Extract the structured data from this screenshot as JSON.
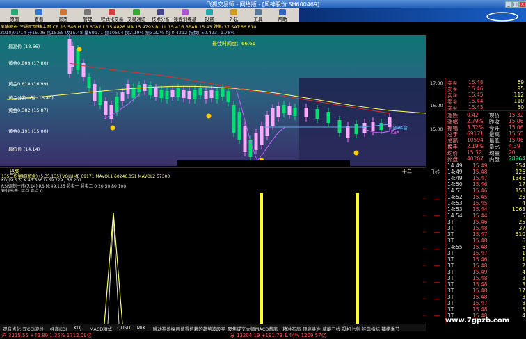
{
  "window": {
    "title": "飞狐交易师 - 网络版 - [风神股份 SH600469]"
  },
  "toolbar": {
    "buttons": [
      "页面",
      "查看",
      "画面",
      "管理",
      "程式化交易",
      "交易通证",
      "技术分析",
      "操盘训练基地",
      "投资",
      "外延",
      "工具",
      "帮助"
    ]
  },
  "info_row1": "风神股份  三线汇聚神主图  CB 15.546  H 15.6087  L 15.4826  MA 15.4793  BULL 15.416  BEAR 15.43  跌勤 37  SAT:66.810",
  "info_row2": "2010/01/14  开15.06 高15.55 收15.48 量69171 额10594  换2.19% 振3.32% 均 0.4212 指数(-50.423)-1.78%",
  "chart": {
    "levels": [
      {
        "label": "最高价 (18.66)"
      },
      {
        "label": "黄金0.809 (17.80)"
      },
      {
        "label": "黄金0.618 (16.99)"
      },
      {
        "label": "黄金分割中轴 (16.40)"
      },
      {
        "label": "黄金0.382 (15.87)"
      },
      {
        "label": "黄金0.191 (15.00)"
      },
      {
        "label": "最低价 (14.14)"
      }
    ],
    "sentiment": "最佳时间度：66.61",
    "right_ticks": [
      "17.00",
      "16.00",
      "15.00"
    ],
    "annotation": "风神平台",
    "annotation2": "KBA"
  },
  "subchart": {
    "row1": "135日均量线(解盘) (5,35,135)  VOLUME 69171  MAVOL1 60246.051  MAVOL2 57300",
    "row2": "KDJ(9,3,3) K 45.886  D 39.729  J 58.201",
    "row3": "RSI调制一纬(7,14)  RSIM:49.136  超卖一  超卖二 0 20 50 80 100",
    "row4": "短线出击: 买点 卖点 0",
    "label_left": "巴黎",
    "label_mid": "十二"
  },
  "lower_ticks": [
    "",
    "",
    "",
    "",
    "",
    "",
    "",
    ""
  ],
  "side": {
    "asks": [
      {
        "label": "卖⑤",
        "price": "15.48",
        "vol": "69"
      },
      {
        "label": "卖④",
        "price": "15.46",
        "vol": "95"
      },
      {
        "label": "卖③",
        "price": "15.45",
        "vol": "112"
      },
      {
        "label": "卖②",
        "price": "15.44",
        "vol": "110"
      },
      {
        "label": "卖①",
        "price": "15.43",
        "vol": "50"
      }
    ],
    "stats": [
      {
        "l": "涨跌",
        "v": "0.42",
        "l2": "现价",
        "v2": "15.32"
      },
      {
        "l": "涨幅",
        "v": "2.79%",
        "l2": "昨收",
        "v2": "15.06"
      },
      {
        "l": "振幅",
        "v": "3.32%",
        "l2": "今开",
        "v2": "15.06"
      },
      {
        "l": "总手",
        "v": "69171",
        "l2": "最高",
        "v2": "15.55"
      },
      {
        "l": "总额",
        "v": "10594",
        "l2": "最低",
        "v2": "15.06"
      },
      {
        "l": "换手",
        "v": "2.19%",
        "l2": "量比",
        "v2": "4.39"
      },
      {
        "l": "均价",
        "v": "15.32",
        "l2": "均量",
        "v2": "20"
      }
    ],
    "waipan": {
      "l": "外盘",
      "v": "40207",
      "l2": "内盘",
      "v2": "28964"
    },
    "ticks": [
      {
        "t": "14:49",
        "p": "15.49",
        "v": "354"
      },
      {
        "t": "14:49",
        "p": "15.48",
        "v": "126"
      },
      {
        "t": "14:49",
        "p": "15.47",
        "v": "1346"
      },
      {
        "t": "14:50",
        "p": "15.46",
        "v": "17"
      },
      {
        "t": "14:51",
        "p": "15.46",
        "v": "153"
      },
      {
        "t": "14:52",
        "p": "15.45",
        "v": "25"
      },
      {
        "t": "14:53",
        "p": "15.45",
        "v": "4"
      },
      {
        "t": "14:53",
        "p": "15.44",
        "v": "1063"
      },
      {
        "t": "14:54",
        "p": "15.44",
        "v": "5"
      },
      {
        "t": "3T",
        "p": "15.46",
        "v": "25"
      },
      {
        "t": "3T",
        "p": "15.48",
        "v": "37"
      },
      {
        "t": "3T",
        "p": "15.47",
        "v": "510"
      },
      {
        "t": "3T",
        "p": "15.48",
        "v": "6"
      },
      {
        "t": "14:55",
        "p": "15.48",
        "v": "6"
      },
      {
        "t": "3T",
        "p": "15.47",
        "v": "1"
      },
      {
        "t": "3T",
        "p": "15.46",
        "v": "1"
      },
      {
        "t": "3T",
        "p": "15.48",
        "v": "2"
      },
      {
        "t": "3T",
        "p": "15.49",
        "v": "4"
      },
      {
        "t": "3T",
        "p": "15.48",
        "v": "3"
      },
      {
        "t": "3T",
        "p": "15.48",
        "v": "3"
      },
      {
        "t": "3T",
        "p": "15.48",
        "v": "17"
      },
      {
        "t": "3T",
        "p": "15.48",
        "v": "3"
      },
      {
        "t": "3T",
        "p": "15.47",
        "v": "8"
      },
      {
        "t": "3T",
        "p": "15.48",
        "v": "5"
      },
      {
        "t": "3T",
        "p": "15.48",
        "v": "4"
      }
    ],
    "tabs": [
      "日线"
    ]
  },
  "bottom_tabs": [
    "观音点化",
    "双CCI波段",
    "经商KDJ",
    "KDJ",
    "MACD精华",
    "QUSD",
    "MIX",
    "跳动神兽探月",
    "值得信赖的趋势",
    "波段买",
    "聚焦成交大师",
    "MACD背离",
    "精准布局",
    "顶底寻准",
    "威廉三线",
    "投机七剑",
    "经典指标",
    "捕捞季节"
  ],
  "status": {
    "sh_label": "沪",
    "sh": "3215.55 +42.89 1.35% 1712.09亿",
    "sz_label": "深",
    "sz": "13204.19 +191.73 1.44% 1209.57亿"
  },
  "watermark": "www.7gpzb.com",
  "colors": {
    "up": "#ff3c3c",
    "down": "#00e0e0",
    "yellow": "#ffff40",
    "magenta": "#ff60ff"
  }
}
